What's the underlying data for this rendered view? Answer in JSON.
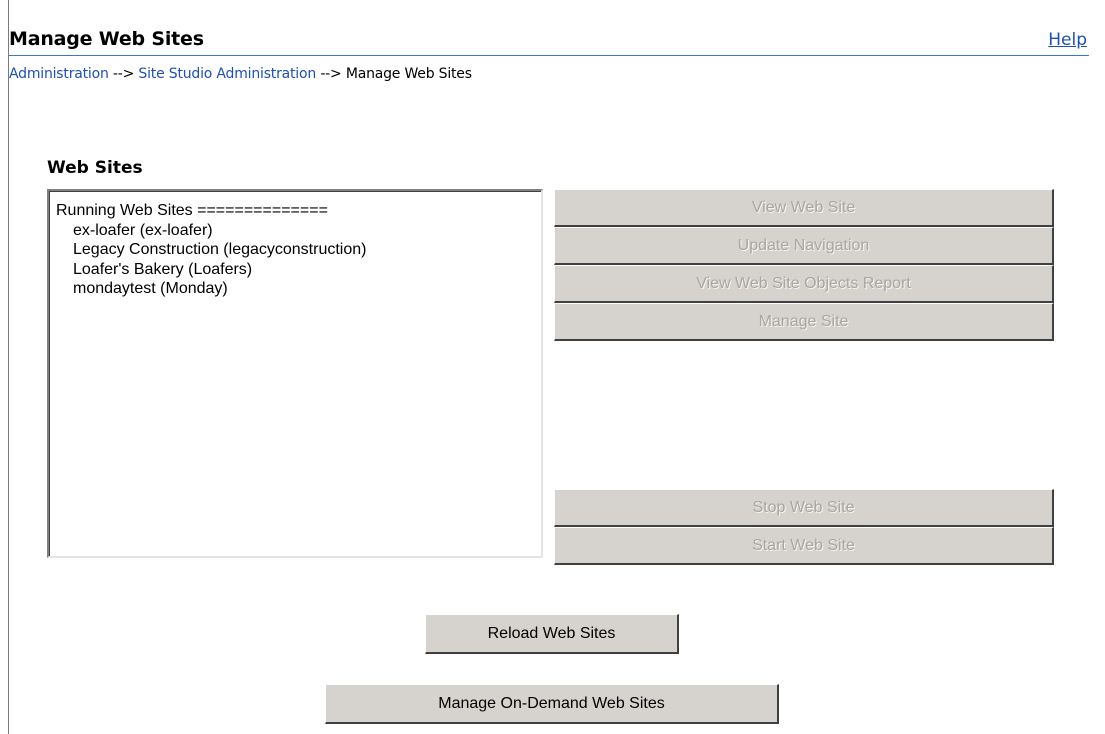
{
  "header": {
    "title": "Manage Web Sites",
    "help_label": "Help"
  },
  "breadcrumb": {
    "items": [
      "Administration",
      "Site Studio Administration",
      "Manage Web Sites"
    ],
    "separator": "-->"
  },
  "web_sites": {
    "heading": "Web Sites",
    "list": [
      "Running Web Sites ==============",
      "ex-loafer (ex-loafer)",
      "Legacy Construction (legacyconstruction)",
      "Loafer's Bakery (Loafers)",
      "mondaytest (Monday)"
    ]
  },
  "actions": {
    "view_web_site": "View Web Site",
    "update_navigation": "Update Navigation",
    "view_objects_report": "View Web Site Objects Report",
    "manage_site": "Manage Site",
    "stop_web_site": "Stop Web Site",
    "start_web_site": "Start Web Site",
    "reload_web_sites": "Reload Web Sites",
    "manage_on_demand": "Manage On-Demand Web Sites"
  },
  "colors": {
    "link": "#1f4fb4",
    "title_rule": "#3a76c9",
    "button_face": "#d6d3ce",
    "disabled_text": "#a9a6a1"
  }
}
